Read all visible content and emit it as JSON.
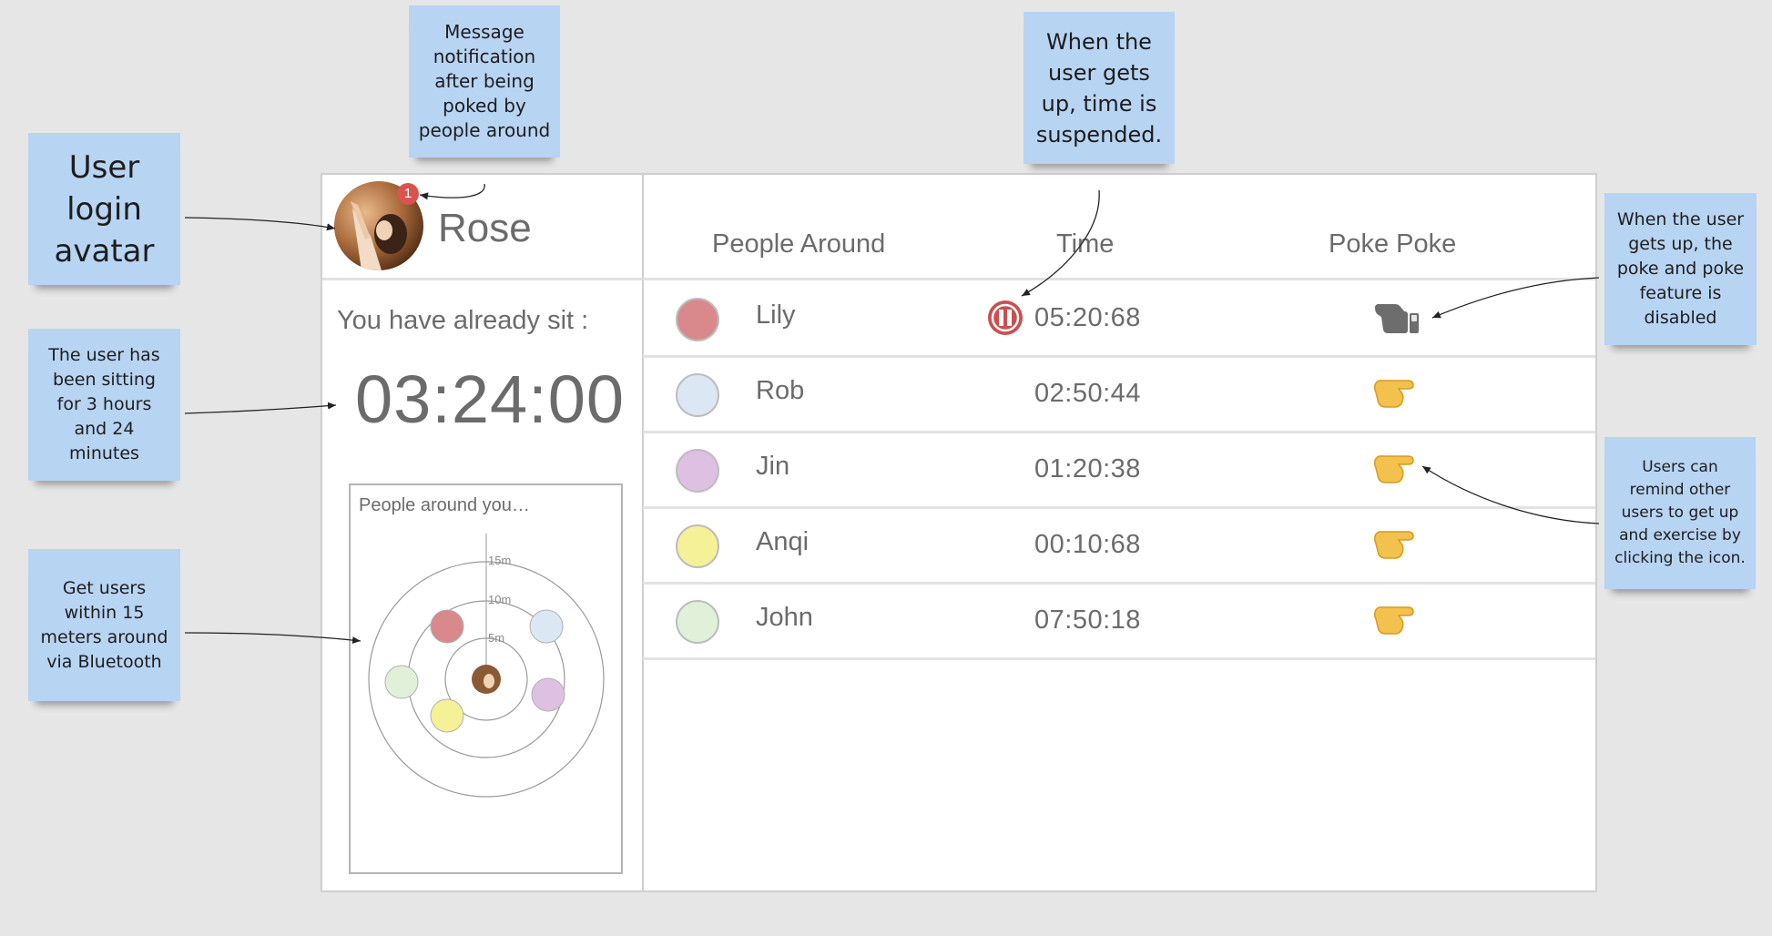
{
  "profile": {
    "name": "Rose",
    "notification_count": "1"
  },
  "sitting": {
    "label": "You have already sit :",
    "time": "03:24:00"
  },
  "radar": {
    "title": "People around you…",
    "rings": [
      "15m",
      "10m",
      "5m"
    ]
  },
  "table": {
    "headers": [
      "People Around",
      "Time",
      "Poke Poke"
    ],
    "rows": [
      {
        "name": "Lily",
        "time": "05:20:68",
        "color": "#d9898b",
        "paused": true,
        "poke_enabled": false
      },
      {
        "name": "Rob",
        "time": "02:50:44",
        "color": "#dce7f4",
        "paused": false,
        "poke_enabled": true
      },
      {
        "name": "Jin",
        "time": "01:20:38",
        "color": "#dec0e3",
        "paused": false,
        "poke_enabled": true
      },
      {
        "name": "Anqi",
        "time": "00:10:68",
        "color": "#f5f197",
        "paused": false,
        "poke_enabled": true
      },
      {
        "name": "John",
        "time": "07:50:18",
        "color": "#e1f0d9",
        "paused": false,
        "poke_enabled": true
      }
    ]
  },
  "notes": {
    "avatar": "User\nlogin\navatar",
    "message": "Message\nnotification\nafter being\npoked by\npeople around",
    "suspended": "When the\nuser gets\nup, time is\nsuspended.",
    "disabled": "When the user\ngets up, the\npoke and poke\nfeature is\ndisabled",
    "sitting": "The user has\nbeen sitting\nfor 3 hours\nand 24\nminutes",
    "bluetooth": "Get users\nwithin 15\nmeters around\nvia Bluetooth",
    "remind": "Users can\nremind other\nusers to get up\nand exercise by\nclicking the icon."
  },
  "colors": {
    "badge": "#d9534f",
    "pause": "#c9504f",
    "note": "#b8d4f3",
    "poke_enabled": "#f2c14e",
    "poke_disabled": "#6d6d6d"
  },
  "icons": {
    "poke": "pointing-hand-icon",
    "pause": "pause-icon",
    "avatar": "user-avatar"
  }
}
